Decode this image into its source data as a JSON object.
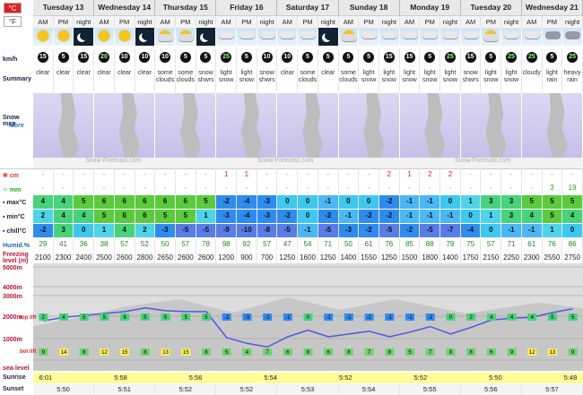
{
  "units": {
    "celsius": "°C",
    "fahrenheit": "°F"
  },
  "days": [
    "Tuesday 13",
    "Wednesday 14",
    "Thursday 15",
    "Friday 16",
    "Saturday 17",
    "Sunday 18",
    "Monday 19",
    "Tuesday 20",
    "Wednesday 21"
  ],
  "periods": [
    "AM",
    "PM",
    "night"
  ],
  "labels": {
    "wind": "km/h",
    "summary": "Summary",
    "snow_map": "Snow map",
    "more": "More",
    "snow_cm": "cm",
    "rain_mm": "mm",
    "max": "max°C",
    "min": "min°C",
    "chill": "chill°C",
    "humid": "Humid.%",
    "freezing": "Freezing level (m)",
    "m5000": "5000m",
    "m4000": "4000m",
    "m3000": "3000m",
    "m2000": "2000m",
    "m1000": "1000m",
    "top_lift": "top lift",
    "bot_lift": "bot lift",
    "sea": "sea-level",
    "sunrise": "Sunrise",
    "sunset": "Sunset",
    "watermark": "Snow-Forecast.com"
  },
  "icons": [
    "sun",
    "sun",
    "moon",
    "sun",
    "sun",
    "moon",
    "sun-cloud",
    "sun-cloud",
    "moon",
    "cloud-snow",
    "cloud-snow",
    "cloud-snow",
    "cloud",
    "cloud",
    "moon",
    "sun-cloud",
    "cloud-snow",
    "cloud-snow",
    "cloud-snow",
    "cloud-snow",
    "cloud-snow",
    "cloud-snow",
    "sun-cloud",
    "cloud",
    "cloud",
    "cloud-rain",
    "cloud-rain"
  ],
  "wind": [
    "15",
    "5",
    "15",
    "20",
    "10",
    "10",
    "10",
    "5",
    "5",
    "25",
    "5",
    "10",
    "10",
    "5",
    "5",
    "5",
    "5",
    "15",
    "15",
    "5",
    "25",
    "15",
    "5",
    "25",
    "25",
    "5",
    "25"
  ],
  "summary": [
    "clear",
    "clear",
    "clear",
    "clear",
    "clear",
    "clear",
    "some clouds",
    "some clouds",
    "snow shwrs",
    "light snow",
    "light snow",
    "snow shwrs",
    "clear",
    "some clouds",
    "clear",
    "some clouds",
    "light snow",
    "light snow",
    "light snow",
    "light snow",
    "light snow",
    "snow shwrs",
    "light snow",
    "light snow",
    "cloudy",
    "light rain",
    "heavy rain"
  ],
  "snow_cm": [
    "-",
    "-",
    "-",
    "-",
    "-",
    "-",
    "-",
    "-",
    "-",
    "1",
    "1",
    "-",
    "-",
    "-",
    "-",
    "-",
    "-",
    "2",
    "1",
    "2",
    "2",
    "-",
    "-",
    "-",
    "-",
    "-",
    "-"
  ],
  "rain_mm": [
    "-",
    "-",
    "-",
    "-",
    "-",
    "-",
    "-",
    "-",
    "-",
    "-",
    "-",
    "-",
    "-",
    "-",
    "-",
    "-",
    "-",
    "-",
    "-",
    "-",
    "-",
    "-",
    "-",
    "-",
    "-",
    "3",
    "19"
  ],
  "max_c": [
    "4",
    "4",
    "5",
    "6",
    "6",
    "6",
    "6",
    "6",
    "5",
    "-2",
    "-4",
    "-3",
    "0",
    "0",
    "-1",
    "0",
    "0",
    "-2",
    "-1",
    "-1",
    "0",
    "1",
    "3",
    "3",
    "5",
    "5",
    "5"
  ],
  "min_c": [
    "2",
    "4",
    "4",
    "5",
    "6",
    "6",
    "5",
    "5",
    "1",
    "-3",
    "-4",
    "-3",
    "-2",
    "0",
    "-2",
    "-1",
    "-2",
    "-2",
    "-1",
    "-1",
    "-1",
    "0",
    "1",
    "3",
    "4",
    "5",
    "4"
  ],
  "chill_c": [
    "-2",
    "3",
    "0",
    "1",
    "4",
    "2",
    "-3",
    "-5",
    "-5",
    "-9",
    "-10",
    "-8",
    "-5",
    "-1",
    "-5",
    "-3",
    "-2",
    "-5",
    "-2",
    "-5",
    "-7",
    "-4",
    "0",
    "-1",
    "-1",
    "1",
    "0"
  ],
  "humidity": [
    "29",
    "41",
    "36",
    "38",
    "57",
    "52",
    "50",
    "57",
    "78",
    "98",
    "92",
    "57",
    "47",
    "54",
    "71",
    "50",
    "61",
    "76",
    "85",
    "88",
    "79",
    "75",
    "57",
    "71",
    "61",
    "76",
    "86"
  ],
  "freezing": [
    "2100",
    "2300",
    "2400",
    "2500",
    "2600",
    "2800",
    "2650",
    "2600",
    "2600",
    "1200",
    "900",
    "700",
    "1250",
    "1600",
    "1250",
    "1400",
    "1550",
    "1250",
    "1500",
    "1800",
    "1400",
    "1750",
    "2150",
    "2250",
    "2300",
    "2550",
    "2750"
  ],
  "top_temps": [
    "2",
    "4",
    "5",
    "5",
    "6",
    "5",
    "5",
    "5",
    "5",
    "-2",
    "-3",
    "-1",
    "-1",
    "0",
    "-1",
    "-1",
    "-1",
    "-1",
    "-1",
    "-1",
    "0",
    "2",
    "4",
    "4",
    "4",
    "5",
    "5"
  ],
  "bot_temps": [
    "9",
    "14",
    "8",
    "12",
    "15",
    "8",
    "13",
    "15",
    "8",
    "5",
    "4",
    "7",
    "6",
    "8",
    "6",
    "8",
    "7",
    "8",
    "5",
    "7",
    "8",
    "8",
    "6",
    "9",
    "12",
    "13",
    "9"
  ],
  "sunrise": [
    "6:01",
    "",
    "",
    "5:58",
    "",
    "",
    "5:56",
    "",
    "",
    "5:54",
    "",
    "",
    "5:52",
    "",
    "",
    "5:52",
    "",
    "",
    "5:50",
    "",
    "",
    "5:48"
  ],
  "sunset": [
    "5:50",
    "5:51",
    "5:52",
    "5:52",
    "5:53",
    "5:54",
    "5:55",
    "5:56",
    "5:57"
  ],
  "colors": {
    "max_bg": [
      "#4e4",
      "#5d5",
      "#6c6",
      "#4a4",
      "#37e",
      "#2a2",
      "#48d",
      "#5a6"
    ],
    "humid": "#26a"
  }
}
